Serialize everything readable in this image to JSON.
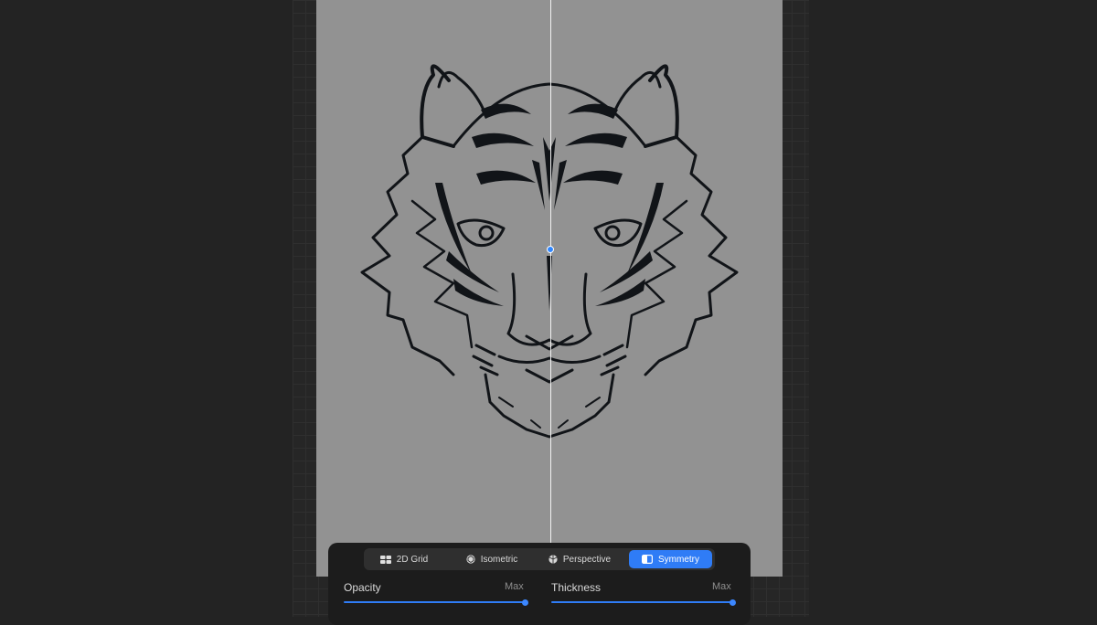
{
  "guide_modes": [
    {
      "label": "2D Grid",
      "icon": "grid-icon",
      "active": false
    },
    {
      "label": "Isometric",
      "icon": "isometric-icon",
      "active": false
    },
    {
      "label": "Perspective",
      "icon": "perspective-icon",
      "active": false
    },
    {
      "label": "Symmetry",
      "icon": "symmetry-icon",
      "active": true
    }
  ],
  "opacity": {
    "label": "Opacity",
    "value_label": "Max",
    "level": 1.0
  },
  "thickness": {
    "label": "Thickness",
    "value_label": "Max",
    "level": 1.0
  },
  "colors": {
    "accent": "#2f7cf6",
    "canvas": "#929292",
    "ink": "#111418"
  }
}
